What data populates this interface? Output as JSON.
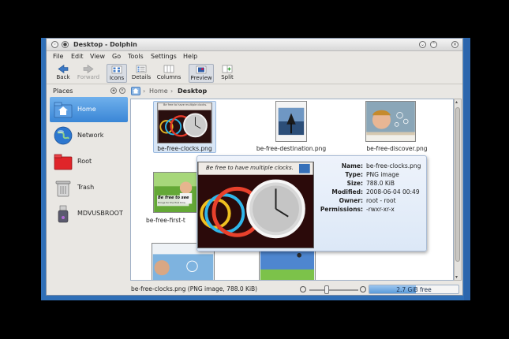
{
  "window": {
    "title": "Desktop - Dolphin"
  },
  "menu": [
    "File",
    "Edit",
    "View",
    "Go",
    "Tools",
    "Settings",
    "Help"
  ],
  "toolbar": {
    "back": "Back",
    "forward": "Forward",
    "icons": "Icons",
    "details": "Details",
    "columns": "Columns",
    "preview": "Preview",
    "split": "Split"
  },
  "places": {
    "header": "Places",
    "items": [
      {
        "label": "Home",
        "selected": true
      },
      {
        "label": "Network"
      },
      {
        "label": "Root"
      },
      {
        "label": "Trash"
      },
      {
        "label": "MDVUSBROOT"
      }
    ]
  },
  "breadcrumb": {
    "home": "Home",
    "current": "Desktop"
  },
  "files": [
    {
      "name": "be-free-clocks.png",
      "selected": true
    },
    {
      "name": "be-free-destination.png"
    },
    {
      "name": "be-free-discover.png"
    },
    {
      "name": "be-free-first-t"
    }
  ],
  "thumb_text": {
    "clocks_small": "Be free to have multiple clocks.",
    "first_small": "Be free to see",
    "first_sub": "things for the first time."
  },
  "tooltip": {
    "caption": "Be free to have multiple clocks.",
    "rows": [
      {
        "key": "Name:",
        "value": "be-free-clocks.png"
      },
      {
        "key": "Type:",
        "value": "PNG image"
      },
      {
        "key": "Size:",
        "value": "788.0 KiB"
      },
      {
        "key": "Modified:",
        "value": "2008-06-04 00:49"
      },
      {
        "key": "Owner:",
        "value": "root - root"
      },
      {
        "key": "Permissions:",
        "value": "-rwxr-xr-x"
      }
    ]
  },
  "status": {
    "message": "be-free-clocks.png (PNG image, 788.0 KiB)",
    "free_space": "2.7 GiB free",
    "free_fill_percent": 52
  },
  "colors": {
    "selection": "#3a86d6",
    "accent": "#2f6fb7"
  }
}
